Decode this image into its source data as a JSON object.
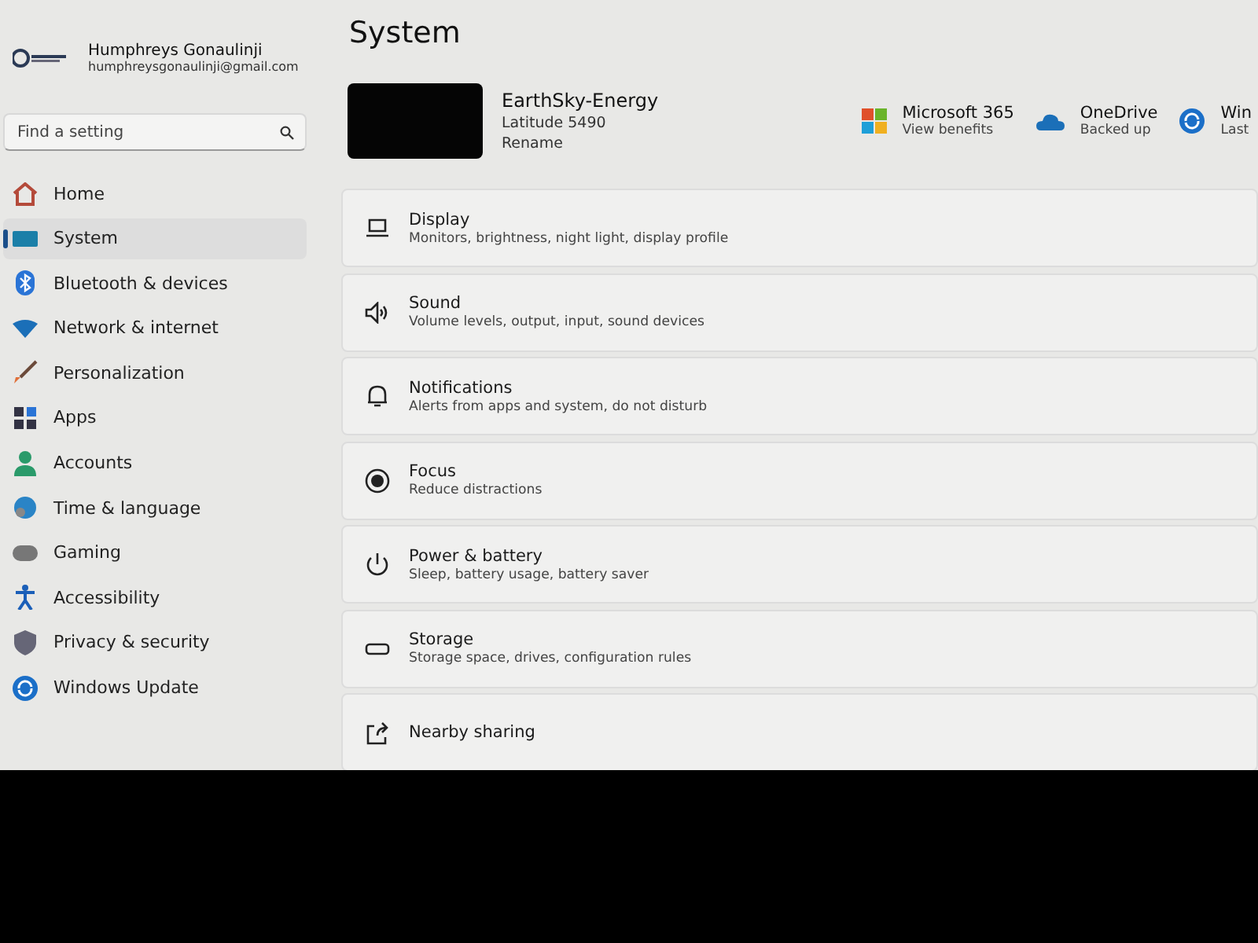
{
  "account": {
    "name": "Humphreys Gonaulinji",
    "email": "humphreysgonaulinji@gmail.com"
  },
  "search": {
    "placeholder": "Find a setting"
  },
  "sidebar": {
    "items": [
      {
        "label": "Home",
        "selected": false
      },
      {
        "label": "System",
        "selected": true
      },
      {
        "label": "Bluetooth & devices",
        "selected": false
      },
      {
        "label": "Network & internet",
        "selected": false
      },
      {
        "label": "Personalization",
        "selected": false
      },
      {
        "label": "Apps",
        "selected": false
      },
      {
        "label": "Accounts",
        "selected": false
      },
      {
        "label": "Time & language",
        "selected": false
      },
      {
        "label": "Gaming",
        "selected": false
      },
      {
        "label": "Accessibility",
        "selected": false
      },
      {
        "label": "Privacy & security",
        "selected": false
      },
      {
        "label": "Windows Update",
        "selected": false
      }
    ]
  },
  "page_title": "System",
  "device": {
    "name": "EarthSky-Energy",
    "model": "Latitude 5490",
    "rename": "Rename"
  },
  "services": [
    {
      "title": "Microsoft 365",
      "subtitle": "View benefits"
    },
    {
      "title": "OneDrive",
      "subtitle": "Backed up"
    },
    {
      "title": "Win",
      "subtitle": "Last"
    }
  ],
  "settings": [
    {
      "title": "Display",
      "subtitle": "Monitors, brightness, night light, display profile"
    },
    {
      "title": "Sound",
      "subtitle": "Volume levels, output, input, sound devices"
    },
    {
      "title": "Notifications",
      "subtitle": "Alerts from apps and system, do not disturb"
    },
    {
      "title": "Focus",
      "subtitle": "Reduce distractions"
    },
    {
      "title": "Power & battery",
      "subtitle": "Sleep, battery usage, battery saver"
    },
    {
      "title": "Storage",
      "subtitle": "Storage space, drives, configuration rules"
    },
    {
      "title": "Nearby sharing"
    }
  ]
}
